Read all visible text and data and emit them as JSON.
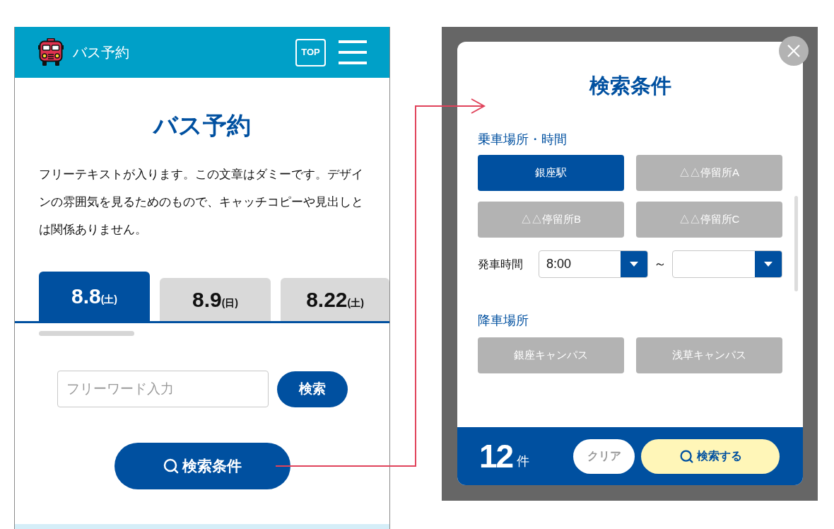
{
  "phone_screen": {
    "header": {
      "title": "バス予約",
      "top_button": "TOP"
    },
    "page_title": "バス予約",
    "intro": "フリーテキストが入ります。この文章はダミーです。デザインの雰囲気を見るためのもので、キャッチコピーや見出しとは関係ありません。",
    "date_tabs": [
      {
        "date": "8.8",
        "weekday": "(土)",
        "selected": true
      },
      {
        "date": "8.9",
        "weekday": "(日)",
        "selected": false
      },
      {
        "date": "8.22",
        "weekday": "(土)",
        "selected": false
      }
    ],
    "search": {
      "placeholder": "フリーワード入力",
      "button": "検索"
    },
    "filter_button": "検索条件"
  },
  "search_modal": {
    "title": "検索条件",
    "sections": [
      {
        "label": "乗車場所・時間",
        "options": [
          {
            "label": "銀座駅",
            "selected": true
          },
          {
            "label": "△△停留所A",
            "selected": false
          },
          {
            "label": "△△停留所B",
            "selected": false
          },
          {
            "label": "△△停留所C",
            "selected": false
          }
        ],
        "time": {
          "label": "発車時間",
          "from": "8:00",
          "separator": "～"
        }
      },
      {
        "label": "降車場所",
        "options": [
          {
            "label": "銀座キャンパス",
            "selected": false
          },
          {
            "label": "浅草キャンパス",
            "selected": false
          }
        ]
      }
    ],
    "footer": {
      "count": "12",
      "count_unit": "件",
      "clear_button": "クリア",
      "submit_button": "検索する"
    }
  }
}
